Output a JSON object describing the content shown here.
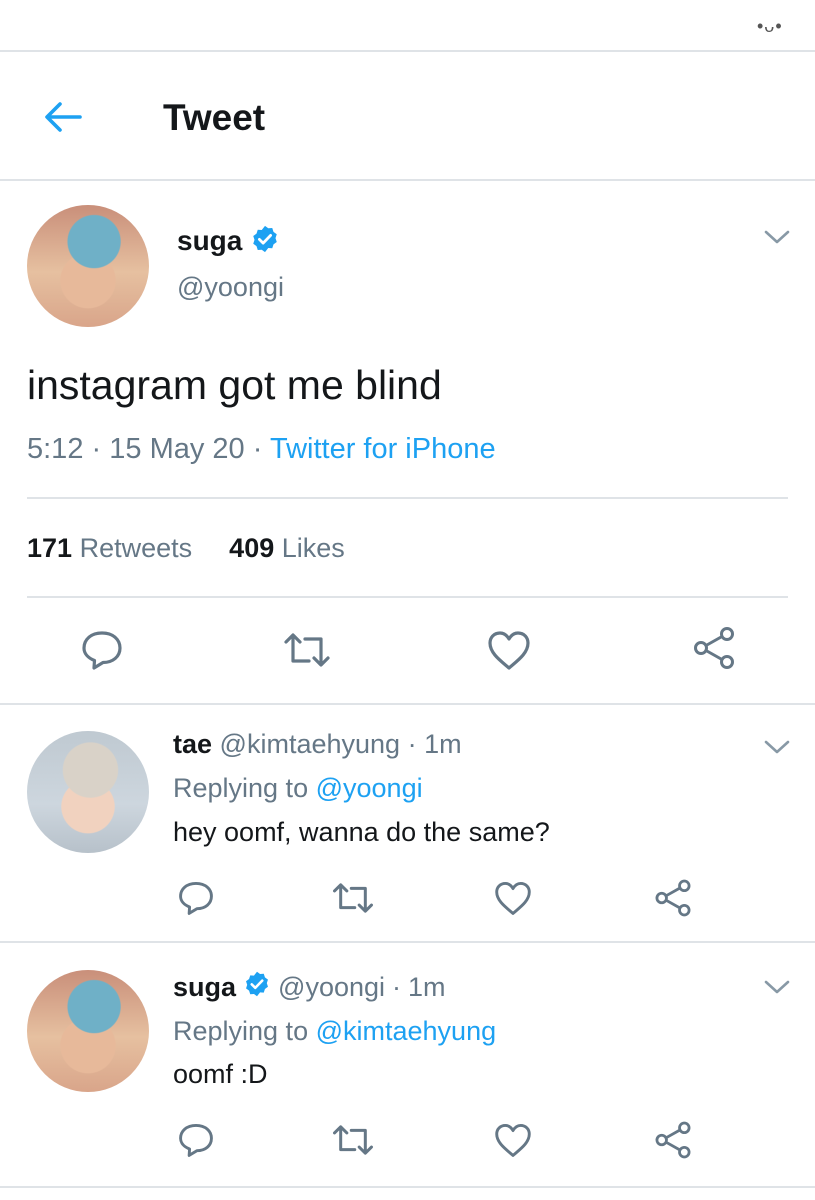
{
  "header": {
    "title": "Tweet"
  },
  "status_bar": {
    "glyph": "•ᴗ•"
  },
  "main_tweet": {
    "display_name": "suga",
    "handle": "@yoongi",
    "text": "instagram got me blind",
    "time": "5:12",
    "date": "15 May 20",
    "source": "Twitter for iPhone",
    "separator": "·",
    "stats": {
      "retweets_count": "171",
      "retweets_label": "Retweets",
      "likes_count": "409",
      "likes_label": "Likes"
    }
  },
  "replies": [
    {
      "display_name": "tae",
      "handle": "@kimtaehyung",
      "time": "1m",
      "replying_label": "Replying to",
      "replying_to": "@yoongi",
      "text": "hey oomf, wanna do the same?",
      "verified": false
    },
    {
      "display_name": "suga",
      "handle": "@yoongi",
      "time": "1m",
      "replying_label": "Replying to",
      "replying_to": "@kimtaehyung",
      "text": "oomf :D",
      "verified": true
    }
  ],
  "icons": {
    "back": "arrow-left-icon",
    "verified": "verified-badge-icon",
    "more": "chevron-down-icon",
    "reply": "reply-icon",
    "retweet": "retweet-icon",
    "like": "heart-icon",
    "share": "share-icon"
  },
  "colors": {
    "accent": "#1da1f2",
    "muted": "#657786",
    "text": "#14171a",
    "divider": "#dfe3e7"
  }
}
